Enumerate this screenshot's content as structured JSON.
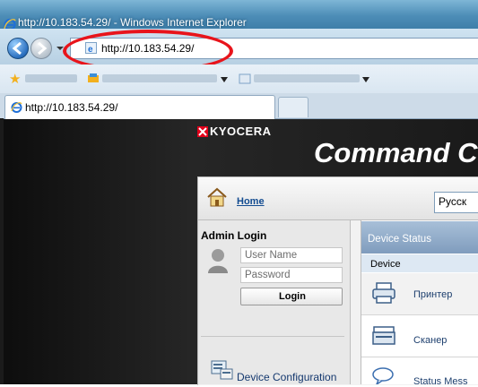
{
  "window": {
    "title": "http://10.183.54.29/ - Windows Internet Explorer"
  },
  "address_bar": {
    "url": "http://10.183.54.29/"
  },
  "tabs": [
    {
      "label": "http://10.183.54.29/"
    }
  ],
  "page": {
    "brand": "KYOCERA",
    "title": "Command C",
    "home_link": "Home",
    "language": "Русск",
    "admin_login": {
      "title": "Admin Login",
      "username_placeholder": "User Name",
      "password_placeholder": "Password",
      "login_label": "Login"
    },
    "device_configuration": "Device Configuration",
    "device_status": {
      "header": "Device Status",
      "device_label": "Device",
      "items": [
        "Принтер",
        "Сканер",
        "Status Mess"
      ]
    }
  },
  "colors": {
    "highlight_circle": "#e8141b",
    "brand_red": "#e2001a",
    "link_blue": "#124b90"
  },
  "icons": [
    "ie-logo-icon",
    "back-arrow-icon",
    "forward-arrow-icon",
    "star-icon",
    "home-icon",
    "user-icon",
    "printer-icon",
    "scanner-icon",
    "message-icon",
    "device-config-icon"
  ]
}
